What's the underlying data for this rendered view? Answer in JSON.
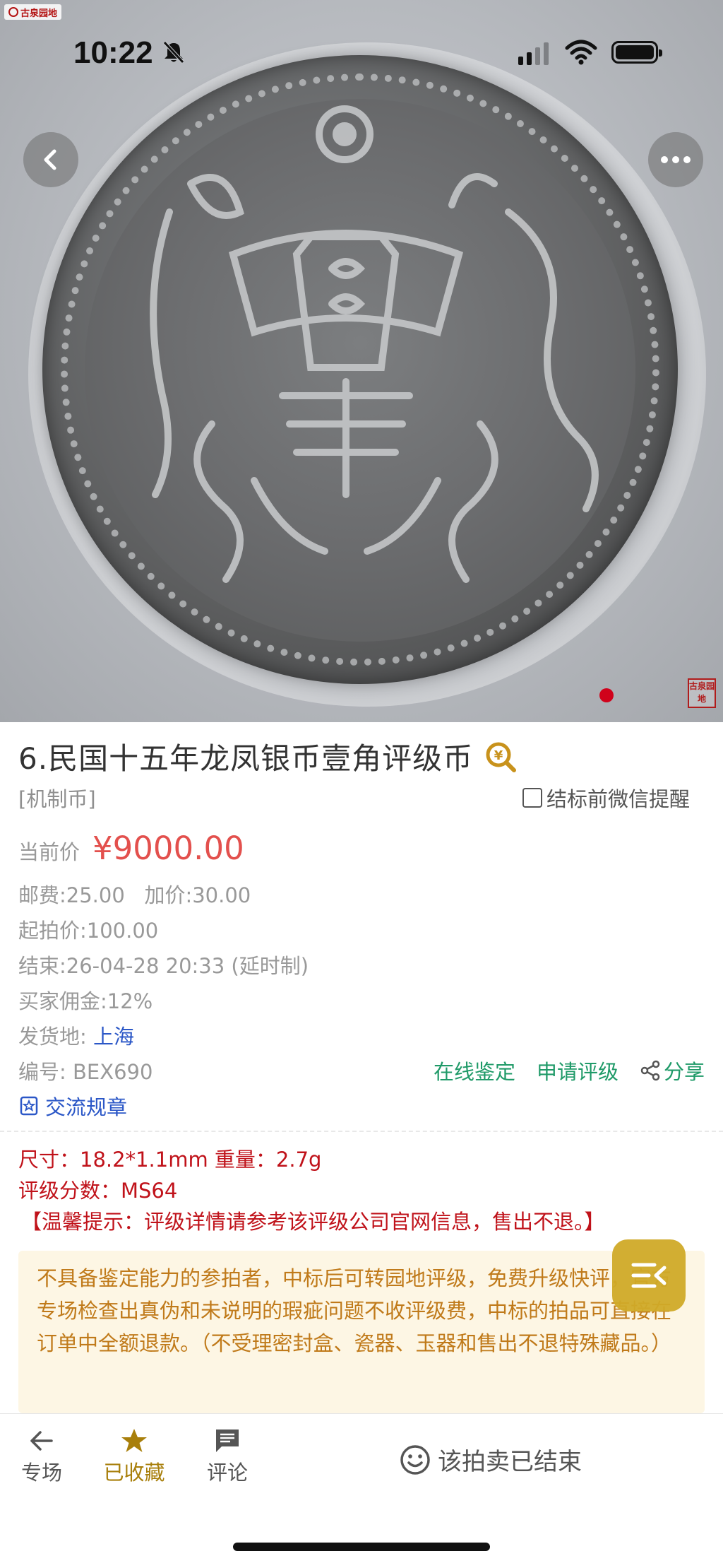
{
  "status_bar": {
    "time": "10:22"
  },
  "hero": {
    "logo_text": "古泉园地",
    "seal_text": "古泉园地",
    "page_indicator": {
      "current": 1
    }
  },
  "lot": {
    "title": "6.民国十五年龙凤银币壹角评级币",
    "category": "[机制币]",
    "remind_label": "结标前微信提醒",
    "price_label": "当前价",
    "price": "¥9000.00",
    "shipping_label": "邮费:25.00",
    "increment_label": "加价:30.00",
    "start_price": "起拍价:100.00",
    "end_time": "结束:26-04-28 20:33 (延时制)",
    "commission": "买家佣金:12%",
    "ship_from_label": "发货地:",
    "ship_from": "上海",
    "code": "编号: BEX690",
    "actions": {
      "appraise": "在线鉴定",
      "grading": "申请评级",
      "share": "分享"
    },
    "rules": "交流规章"
  },
  "specs": {
    "size_weight": "尺寸：18.2*1.1mm 重量：2.7g",
    "grade": "评级分数：MS64",
    "tip": "【温馨提示：评级详情请参考该评级公司官网信息，售出不退。】"
  },
  "notice": {
    "text": "不具备鉴定能力的参拍者，中标后可转园地评级，免费升级快评，官方专场检查出真伪和未说明的瑕疵问题不收评级费，中标的拍品可直接在订单中全额退款。（不受理密封盒、瓷器、玉器和售出不退特殊藏品。）"
  },
  "bottom_bar": {
    "venue": "专场",
    "favorited": "已收藏",
    "comment": "评论",
    "ended": "该拍卖已结束"
  },
  "colors": {
    "price_red": "#e3504d",
    "spec_red": "#c0121a",
    "action_green": "#1f9a68",
    "link_blue": "#2b57c7",
    "notice_bg": "#fdf6e4",
    "notice_text": "#c07a1a",
    "fab_gold": "#d0aa28"
  },
  "icons": [
    "bell-slash-icon",
    "signal-icon",
    "wifi-icon",
    "battery-icon",
    "back-icon",
    "more-icon",
    "zoom-yuan-icon",
    "share-icon",
    "rules-icon",
    "menu-collapse-icon",
    "arrow-left-icon",
    "star-icon",
    "comment-icon",
    "smiley-icon"
  ]
}
